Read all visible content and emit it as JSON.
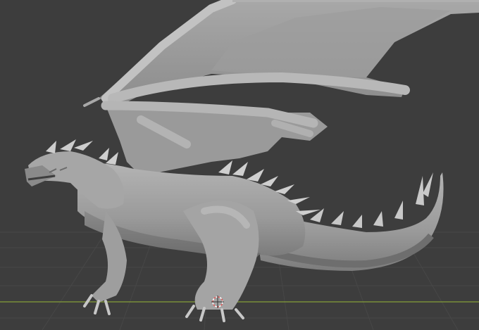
{
  "viewport": {
    "view": "perspective",
    "background": "#3d3d3d",
    "grid_line_color": "#484848",
    "x_axis_color": "#7a8f3a",
    "mesh_color": "#a2a2a2",
    "mesh_shadow": "#6e6e6e",
    "mesh_highlight": "#c4c4c4",
    "object": "dragon-sculpt",
    "origin_marker": "3d-cursor-icon"
  }
}
